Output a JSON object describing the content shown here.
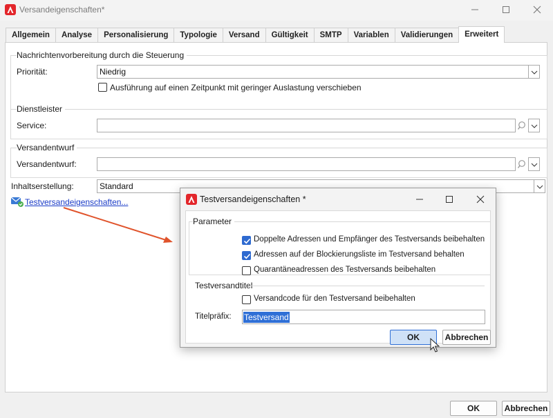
{
  "window": {
    "title": "Versandeigenschaften*",
    "accent": "#e3262b"
  },
  "tabs": [
    "Allgemein",
    "Analyse",
    "Personalisierung",
    "Typologie",
    "Versand",
    "Gültigkeit",
    "SMTP",
    "Variablen",
    "Validierungen",
    "Erweitert"
  ],
  "active_tab": "Erweitert",
  "sections": {
    "nachricht": {
      "title": "Nachrichtenvorbereitung durch die Steuerung",
      "priority_label": "Priorität:",
      "priority_value": "Niedrig",
      "defer_label": "Ausführung auf einen Zeitpunkt mit geringer Auslastung verschieben",
      "defer_checked": false
    },
    "dienstleister": {
      "title": "Dienstleister",
      "service_label": "Service:",
      "service_value": ""
    },
    "versandentwurf": {
      "title": "Versandentwurf",
      "label": "Versandentwurf:",
      "value": ""
    },
    "inhalt": {
      "label": "Inhaltserstellung:",
      "value": "Standard"
    },
    "test_link": "Testversandeigenschaften..."
  },
  "footer": {
    "ok": "OK",
    "cancel": "Abbrechen"
  },
  "dialog": {
    "title": "Testversandeigenschaften *",
    "parameter_title": "Parameter",
    "options": [
      {
        "label": "Doppelte Adressen und Empfänger des Testversands beibehalten",
        "checked": true
      },
      {
        "label": "Adressen auf der Blockierungsliste im Testversand behalten",
        "checked": true
      },
      {
        "label": "Quarantäneadressen des Testversands beibehalten",
        "checked": false
      }
    ],
    "testversandtitel_title": "Testversandtitel",
    "keep_code_label": "Versandcode für den Testversand beibehalten",
    "keep_code_checked": false,
    "prefix_label": "Titelpräfix:",
    "prefix_value": "Testversand",
    "ok": "OK",
    "cancel": "Abbrechen"
  }
}
